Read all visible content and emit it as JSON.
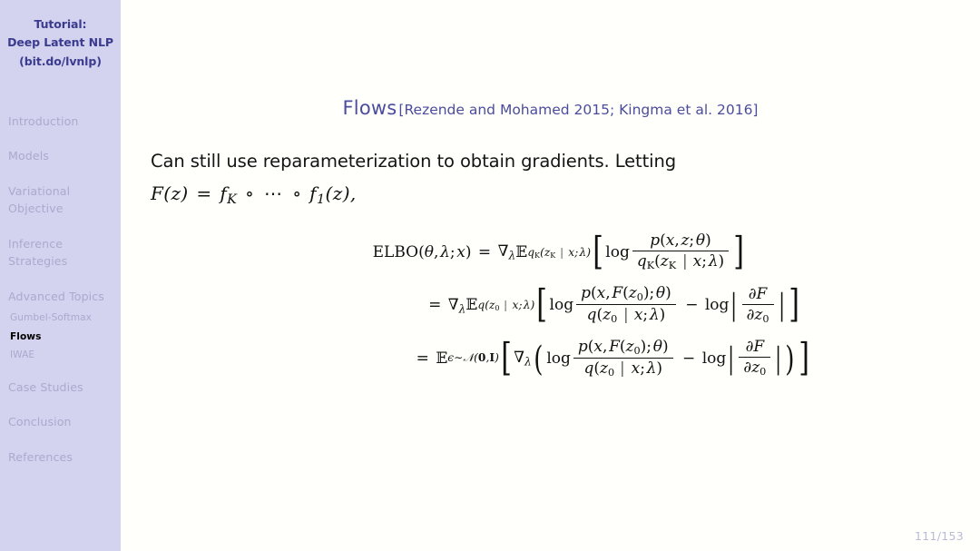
{
  "sidebar": {
    "title_lines": [
      "Tutorial:",
      "Deep Latent NLP",
      "(bit.do/lvnlp)"
    ],
    "sections": [
      {
        "label": "Introduction",
        "current": false,
        "subitems": []
      },
      {
        "label": "Models",
        "current": false,
        "subitems": []
      },
      {
        "label": "Variational Objective",
        "current": false,
        "subitems": []
      },
      {
        "label": "Inference Strategies",
        "current": false,
        "subitems": []
      },
      {
        "label": "Advanced Topics",
        "current": false,
        "subitems": [
          {
            "label": "Gumbel-Softmax",
            "current": false
          },
          {
            "label": "Flows",
            "current": true
          },
          {
            "label": "IWAE",
            "current": false
          }
        ]
      },
      {
        "label": "Case Studies",
        "current": false,
        "subitems": []
      },
      {
        "label": "Conclusion",
        "current": false,
        "subitems": []
      },
      {
        "label": "References",
        "current": false,
        "subitems": []
      }
    ],
    "colors": {
      "background": "#d3d3ef",
      "title_text": "#3b3b8f",
      "inactive_text": "#aaaace",
      "active_text": "#000000"
    }
  },
  "main": {
    "frame_title": "Flows",
    "frame_citation": "[Rezende and Mohamed 2015; Kingma et al. 2016]",
    "title_color": "#4c4c9d",
    "body_text": "Can still use reparameterization to obtain gradients.  Letting",
    "composition_equation": "F(z) = f_K ∘ ⋯ ∘ f_1(z),",
    "equations": {
      "line1": {
        "lhs": "ELBO(θ, λ; x)",
        "relation": "=",
        "operator": "∇_λ E_{q_K(z_K | x; λ)}",
        "bracket_content": "log  p(x, z; θ) / q_K(z_K | x; λ)"
      },
      "line2": {
        "relation": "=",
        "operator": "∇_λ E_{q(z_0 | x; λ)}",
        "bracket_content": "log  p(x, F(z_0); θ) / q(z_0 | x; λ)  −  log |∂F/∂z_0|"
      },
      "line3": {
        "relation": "=",
        "operator": "E_{ε∼N(0,I)}",
        "bracket_content": "∇_λ ( log  p(x, F(z_0); θ) / q(z_0 | x; λ)  −  log |∂F/∂z_0| )"
      },
      "fraction_numerator_1": "p(x, z; θ)",
      "fraction_denominator_1": "q_K(z_K | x; λ)",
      "fraction_numerator_2": "p(x, F(z_0); θ)",
      "fraction_denominator_2": "q(z_0 | x; λ)",
      "derivative_numerator": "∂F",
      "derivative_denominator": "∂z_0"
    }
  },
  "footer": {
    "page_number": "111/153",
    "color": "#babad8"
  }
}
